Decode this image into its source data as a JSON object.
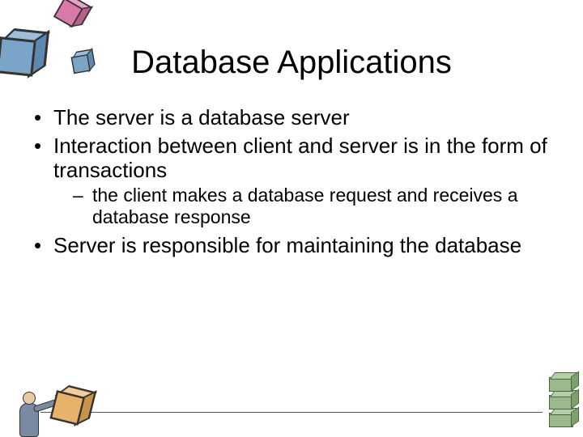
{
  "title": "Database Applications",
  "bullets": {
    "b1": "The server is a database server",
    "b2": "Interaction between client and server is in the form of transactions",
    "b2_sub1": "the client makes a database request and receives a database response",
    "b3": "Server is responsible for maintaining the database"
  }
}
